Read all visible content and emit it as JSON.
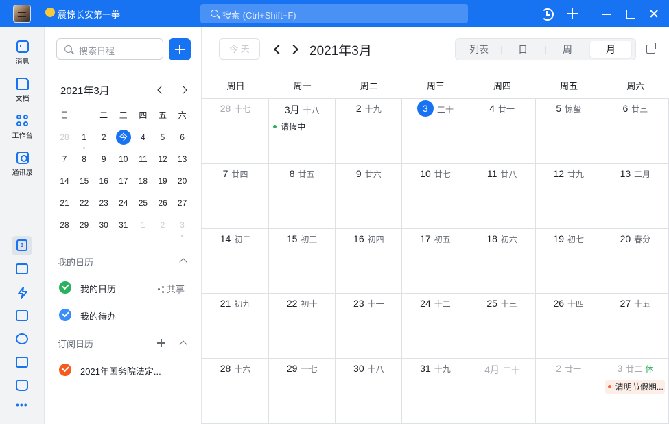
{
  "titlebar": {
    "username": "震惊长安第一拳",
    "search_placeholder": "搜索 (Ctrl+Shift+F)"
  },
  "rail": {
    "items": [
      {
        "label": "消息",
        "icon": "message-icon"
      },
      {
        "label": "文档",
        "icon": "doc-icon"
      },
      {
        "label": "工作台",
        "icon": "workbench-icon"
      },
      {
        "label": "通讯录",
        "icon": "contacts-icon"
      }
    ],
    "calendar_badge": "3"
  },
  "sidebar": {
    "search_placeholder": "搜索日程",
    "mini_title": "2021年3月",
    "weekdays": [
      "日",
      "一",
      "二",
      "三",
      "四",
      "五",
      "六"
    ],
    "weeks": [
      [
        "28",
        "1",
        "2",
        "今",
        "4",
        "5",
        "6"
      ],
      [
        "7",
        "8",
        "9",
        "10",
        "11",
        "12",
        "13"
      ],
      [
        "14",
        "15",
        "16",
        "17",
        "18",
        "19",
        "20"
      ],
      [
        "21",
        "22",
        "23",
        "24",
        "25",
        "26",
        "27"
      ],
      [
        "28",
        "29",
        "30",
        "31",
        "1",
        "2",
        "3"
      ]
    ],
    "my_calendars_title": "我的日历",
    "my_calendars": [
      {
        "name": "我的日历",
        "color": "#2ab15d",
        "share": "共享"
      },
      {
        "name": "我的待办",
        "color": "#3a8ef7"
      }
    ],
    "subscribed_title": "订阅日历",
    "subscribed": [
      {
        "name": "2021年国务院法定...",
        "color": "#f55a1e"
      }
    ]
  },
  "main": {
    "today_label": "今 天",
    "title": "2021年3月",
    "views": [
      "列表",
      "日",
      "周",
      "月"
    ],
    "active_view": "月",
    "weekdays": [
      "周日",
      "周一",
      "周二",
      "周三",
      "周四",
      "周五",
      "周六"
    ],
    "weeks": [
      [
        {
          "d": "28",
          "l": "十七",
          "muted": true
        },
        {
          "d": "3月",
          "l": "十八",
          "event": "请假中",
          "event_color": "#2ab15d"
        },
        {
          "d": "2",
          "l": "十九"
        },
        {
          "d": "3",
          "l": "二十",
          "today": true
        },
        {
          "d": "4",
          "l": "廿一"
        },
        {
          "d": "5",
          "l": "惊蛰"
        },
        {
          "d": "6",
          "l": "廿三"
        }
      ],
      [
        {
          "d": "7",
          "l": "廿四"
        },
        {
          "d": "8",
          "l": "廿五"
        },
        {
          "d": "9",
          "l": "廿六"
        },
        {
          "d": "10",
          "l": "廿七"
        },
        {
          "d": "11",
          "l": "廿八"
        },
        {
          "d": "12",
          "l": "廿九"
        },
        {
          "d": "13",
          "l": "二月"
        }
      ],
      [
        {
          "d": "14",
          "l": "初二"
        },
        {
          "d": "15",
          "l": "初三"
        },
        {
          "d": "16",
          "l": "初四"
        },
        {
          "d": "17",
          "l": "初五"
        },
        {
          "d": "18",
          "l": "初六"
        },
        {
          "d": "19",
          "l": "初七"
        },
        {
          "d": "20",
          "l": "春分"
        }
      ],
      [
        {
          "d": "21",
          "l": "初九"
        },
        {
          "d": "22",
          "l": "初十"
        },
        {
          "d": "23",
          "l": "十一"
        },
        {
          "d": "24",
          "l": "十二"
        },
        {
          "d": "25",
          "l": "十三"
        },
        {
          "d": "26",
          "l": "十四"
        },
        {
          "d": "27",
          "l": "十五"
        }
      ],
      [
        {
          "d": "28",
          "l": "十六"
        },
        {
          "d": "29",
          "l": "十七"
        },
        {
          "d": "30",
          "l": "十八"
        },
        {
          "d": "31",
          "l": "十九"
        },
        {
          "d": "4月",
          "l": "二十",
          "muted": true
        },
        {
          "d": "2",
          "l": "廿一",
          "muted": true
        },
        {
          "d": "3",
          "l": "廿二",
          "muted": true,
          "rest": "休",
          "event": "清明节假期...",
          "event_color": "#f56c3a",
          "holiday": true
        }
      ]
    ]
  }
}
